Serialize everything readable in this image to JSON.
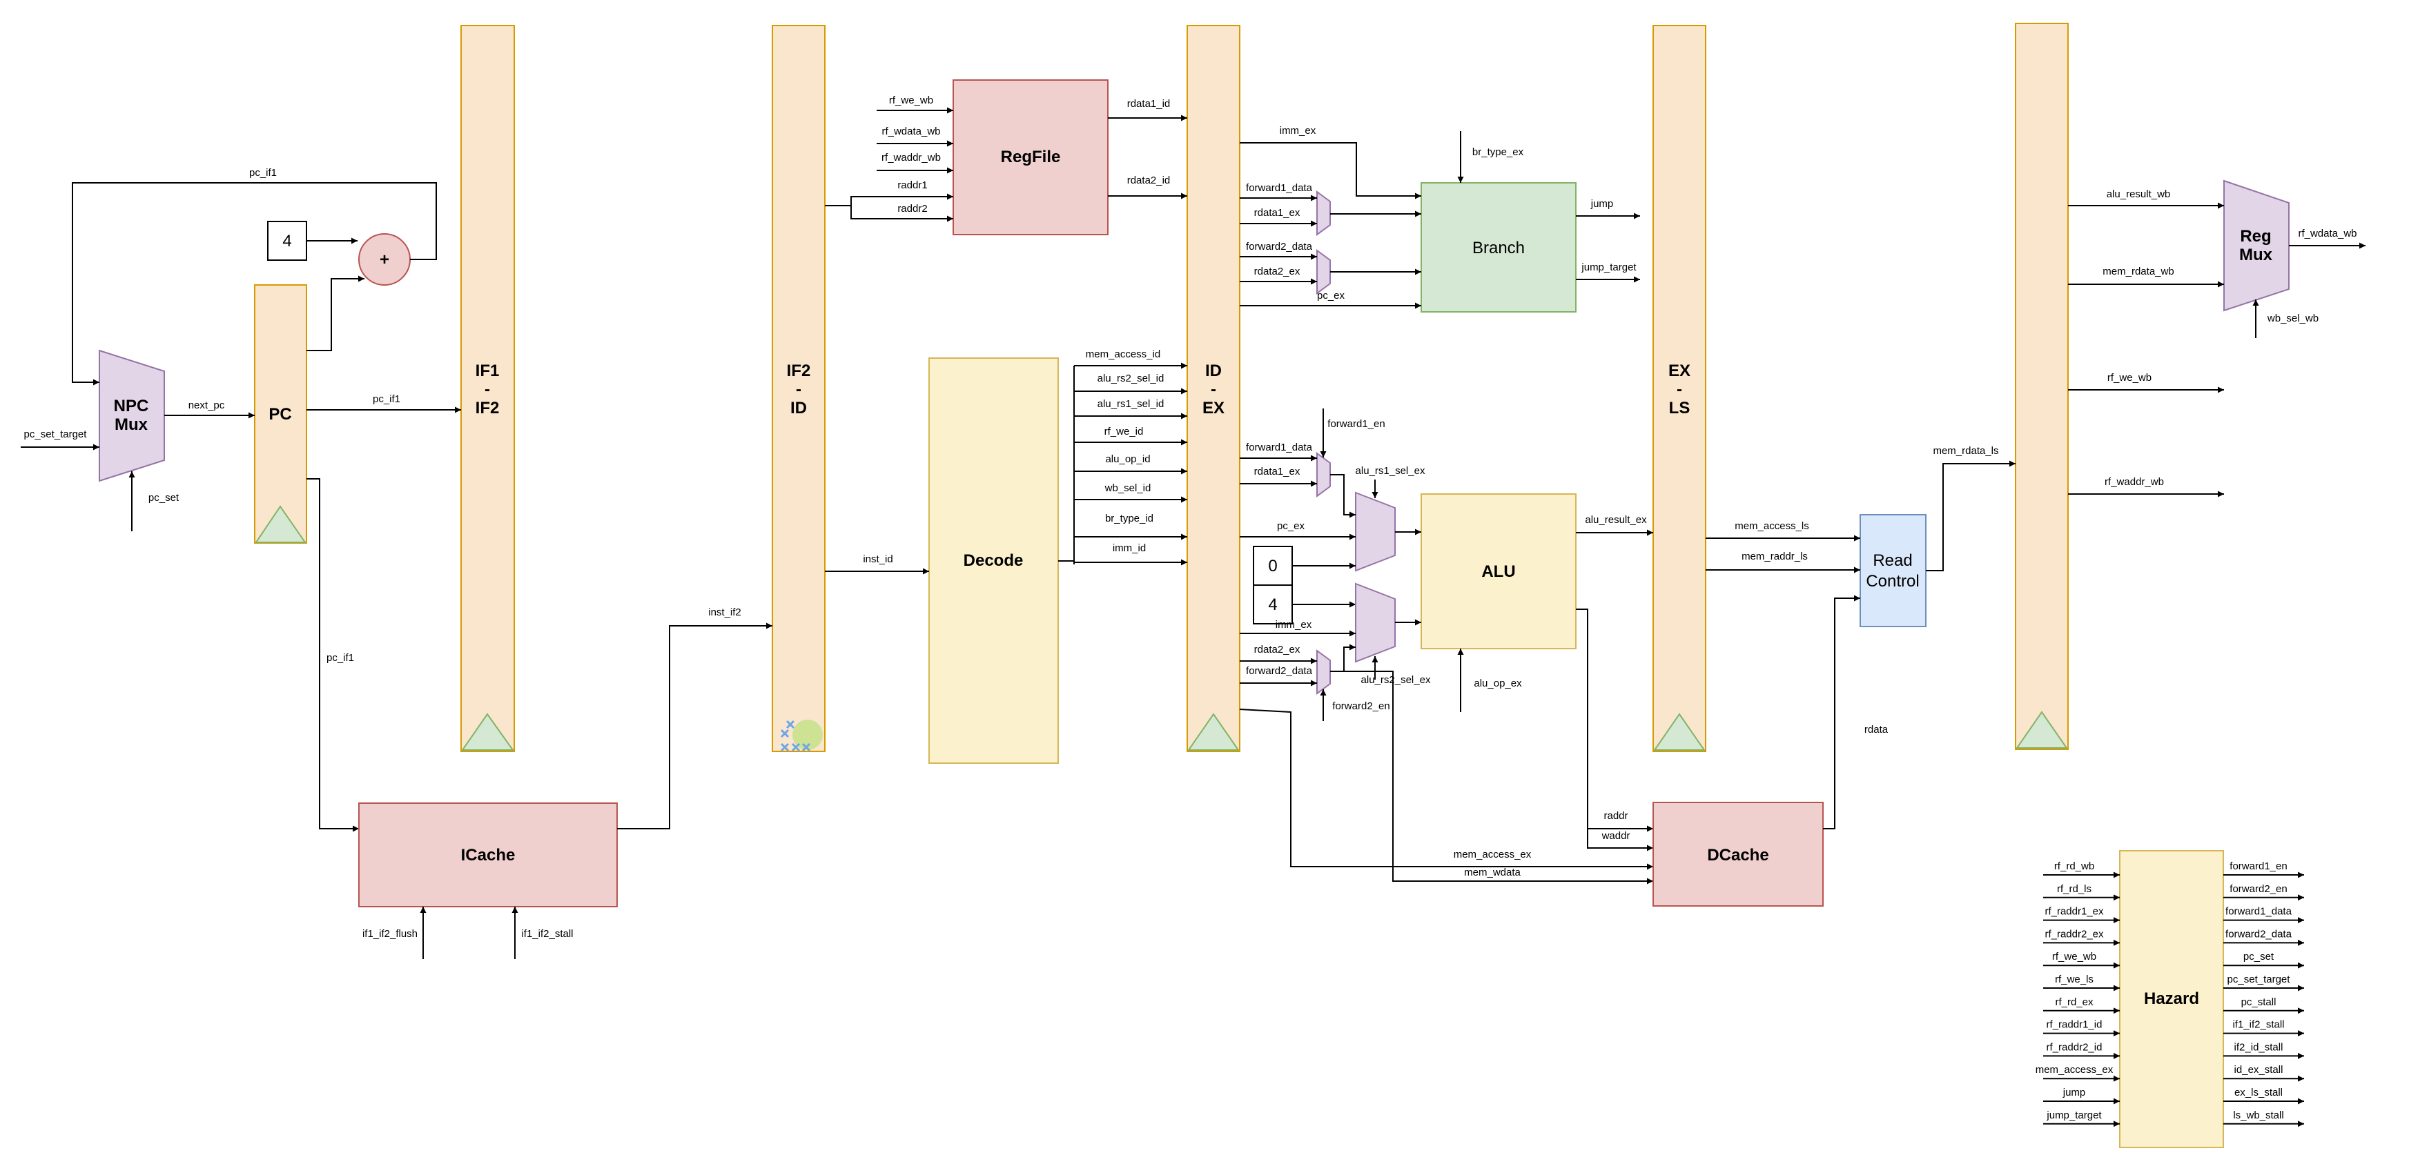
{
  "colors": {
    "pipeline_register": "#fae6cd",
    "pipeline_register_border": "#d79b00",
    "clock_triangle": "#d5e8d4",
    "mux": "#e1d5e7",
    "mux_border": "#9673a6",
    "memory_block": "#f0cfcf",
    "memory_border": "#b85450",
    "decode_alu": "#fbf1cc",
    "decode_border": "#d6b656",
    "branch": "#d5e8d4",
    "branch_border": "#82b366",
    "read_control": "#dae8fc",
    "read_control_border": "#6c8ebf",
    "highlight": "#b9e07a",
    "cross_marker": "#6ea6e6"
  },
  "blocks": {
    "npc_mux": [
      "NPC",
      "Mux"
    ],
    "pc": "PC",
    "adder": "+",
    "const_4": "4",
    "if1_if2": [
      "IF1",
      "-",
      "IF2"
    ],
    "if2_id": [
      "IF2",
      "-",
      "ID"
    ],
    "id_ex": [
      "ID",
      "-",
      "EX"
    ],
    "ex_ls": [
      "EX",
      "-",
      "LS"
    ],
    "regfile": "RegFile",
    "decode": "Decode",
    "branch": "Branch",
    "alu": "ALU",
    "const_0": "0",
    "const_4b": "4",
    "icache": "ICache",
    "dcache": "DCache",
    "read_control": [
      "Read",
      "Control"
    ],
    "reg_mux": [
      "Reg",
      "Mux"
    ],
    "hazard": "Hazard"
  },
  "signals": {
    "pc_if1_top": "pc_if1",
    "next_pc": "next_pc",
    "pc_set_target": "pc_set_target",
    "pc_set": "pc_set",
    "pc_if1_mid": "pc_if1",
    "pc_if1_down": "pc_if1",
    "inst_if2": "inst_if2",
    "if1_if2_flush": "if1_if2_flush",
    "if1_if2_stall": "if1_if2_stall",
    "inst_id": "inst_id",
    "rf_we_wb_in": "rf_we_wb",
    "rf_wdata_wb_in": "rf_wdata_wb",
    "rf_waddr_wb_in": "rf_waddr_wb",
    "raddr1": "raddr1",
    "raddr2": "raddr2",
    "rdata1_id": "rdata1_id",
    "rdata2_id": "rdata2_id",
    "mem_access_id": "mem_access_id",
    "alu_rs2_sel_id": "alu_rs2_sel_id",
    "alu_rs1_sel_id": "alu_rs1_sel_id",
    "rf_we_id": "rf_we_id",
    "alu_op_id": "alu_op_id",
    "wb_sel_id": "wb_sel_id",
    "br_type_id": "br_type_id",
    "imm_id": "imm_id",
    "imm_ex_top": "imm_ex",
    "br_type_ex": "br_type_ex",
    "forward1_data_top": "forward1_data",
    "rdata1_ex_top": "rdata1_ex",
    "forward2_data_top": "forward2_data",
    "rdata2_ex_top": "rdata2_ex",
    "pc_ex_top": "pc_ex",
    "jump": "jump",
    "jump_target": "jump_target",
    "forward1_en": "forward1_en",
    "forward1_data_mid": "forward1_data",
    "rdata1_ex_mid": "rdata1_ex",
    "alu_rs1_sel_ex": "alu_rs1_sel_ex",
    "pc_ex_mid": "pc_ex",
    "imm_ex_mid": "imm_ex",
    "rdata2_ex_mid": "rdata2_ex",
    "forward2_data_mid": "forward2_data",
    "alu_rs2_sel_ex": "alu_rs2_sel_ex",
    "forward2_en": "forward2_en",
    "alu_op_ex": "alu_op_ex",
    "alu_result_ex": "alu_result_ex",
    "mem_access_ls": "mem_access_ls",
    "mem_raddr_ls": "mem_raddr_ls",
    "raddr": "raddr",
    "waddr": "waddr",
    "mem_access_ex": "mem_access_ex",
    "mem_wdata": "mem_wdata",
    "rdata": "rdata",
    "mem_rdata_ls": "mem_rdata_ls",
    "alu_result_wb": "alu_result_wb",
    "mem_rdata_wb": "mem_rdata_wb",
    "wb_sel_wb": "wb_sel_wb",
    "rf_wdata_wb_out": "rf_wdata_wb",
    "rf_we_wb_out": "rf_we_wb",
    "rf_waddr_wb_out": "rf_waddr_wb"
  },
  "hazard": {
    "inputs": [
      "rf_rd_wb",
      "rf_rd_ls",
      "rf_raddr1_ex",
      "rf_raddr2_ex",
      "rf_we_wb",
      "rf_we_ls",
      "rf_rd_ex",
      "rf_raddr1_id",
      "rf_raddr2_id",
      "mem_access_ex",
      "jump",
      "jump_target"
    ],
    "outputs": [
      "forward1_en",
      "forward2_en",
      "forward1_data",
      "forward2_data",
      "pc_set",
      "pc_set_target",
      "pc_stall",
      "if1_if2_stall",
      "if2_id_stall",
      "id_ex_stall",
      "ex_ls_stall",
      "ls_wb_stall"
    ]
  }
}
